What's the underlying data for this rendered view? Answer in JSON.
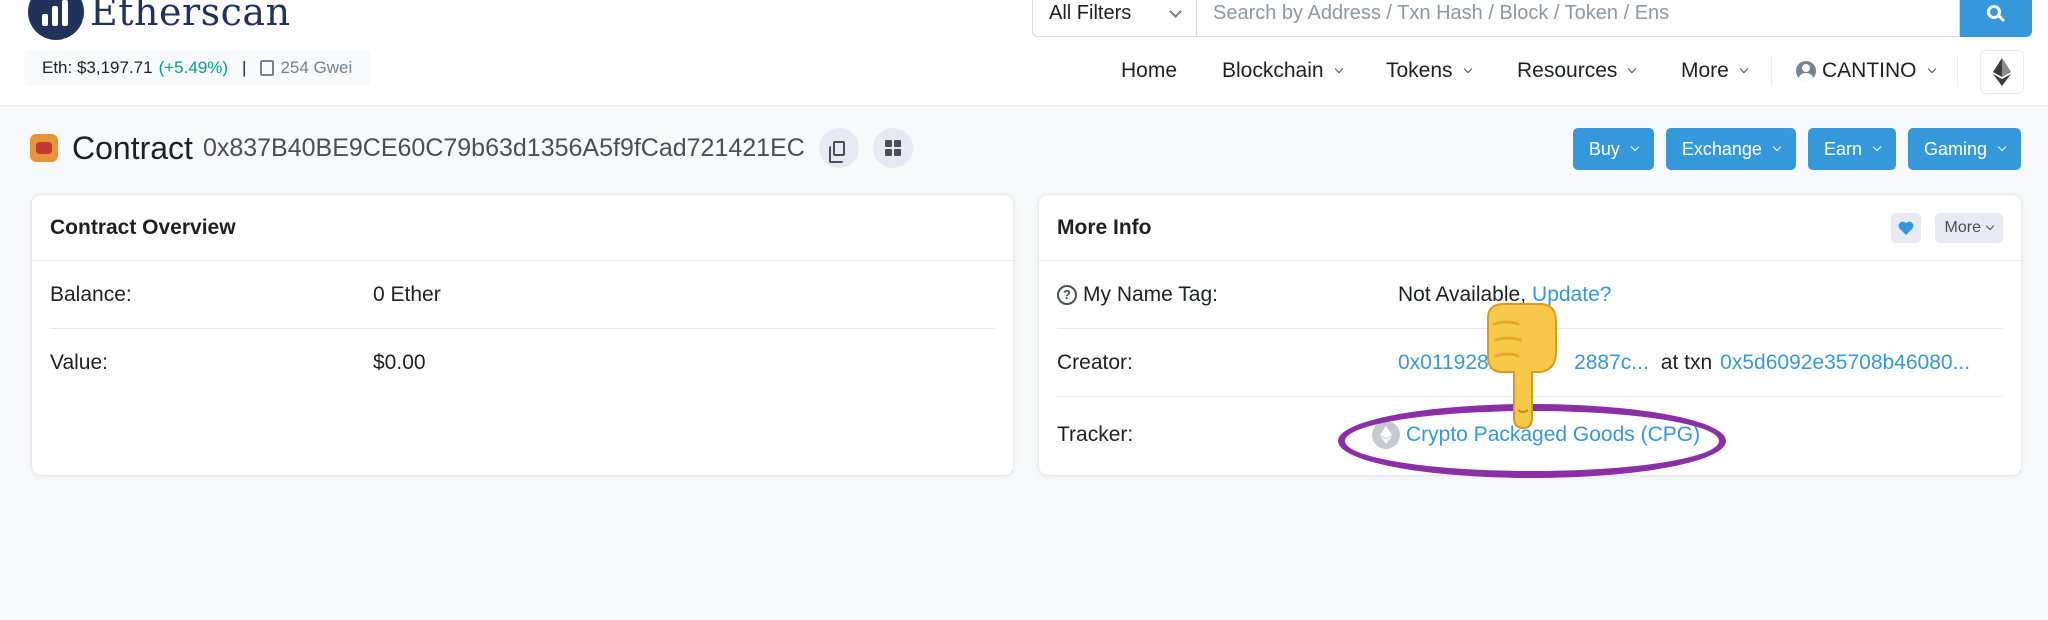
{
  "header": {
    "logo_text": "Etherscan",
    "eth_price_label": "Eth: $3,197.71",
    "eth_change": "(+5.49%)",
    "separator": "|",
    "gas": "254 Gwei",
    "search": {
      "filter_label": "All Filters",
      "placeholder": "Search by Address / Txn Hash / Block / Token / Ens"
    },
    "nav": {
      "home": "Home",
      "blockchain": "Blockchain",
      "tokens": "Tokens",
      "resources": "Resources",
      "more": "More",
      "user": "CANTINO"
    }
  },
  "contract": {
    "title_word": "Contract",
    "address": "0x837B40BE9CE60C79b63d1356A5f9fCad721421EC",
    "action_buttons": [
      "Buy",
      "Exchange",
      "Earn",
      "Gaming"
    ]
  },
  "overview": {
    "title": "Contract Overview",
    "balance_label": "Balance:",
    "balance_value": "0 Ether",
    "value_label": "Value:",
    "value_value": "$0.00"
  },
  "more_info": {
    "title": "More Info",
    "more_label": "More",
    "name_tag_label": "My Name Tag:",
    "name_tag_value": "Not Available,",
    "name_tag_link": "Update?",
    "creator_label": "Creator:",
    "creator_address": "0x011928b4",
    "creator_address_tail": "2887c...",
    "at_txn": "at txn",
    "creator_txn": "0x5d6092e35708b46080...",
    "tracker_label": "Tracker:",
    "tracker_value": "Crypto Packaged Goods (CPG)"
  },
  "colors": {
    "accent": "#3498db",
    "positive": "#00a186",
    "annotation": "#8b2fa8"
  },
  "icons": [
    "search-icon",
    "gas-pump-icon",
    "user-circle-icon",
    "ethereum-icon",
    "copy-icon",
    "qr-code-icon",
    "help-circle-icon",
    "heart-icon",
    "token-icon",
    "pointing-hand-emoji"
  ]
}
